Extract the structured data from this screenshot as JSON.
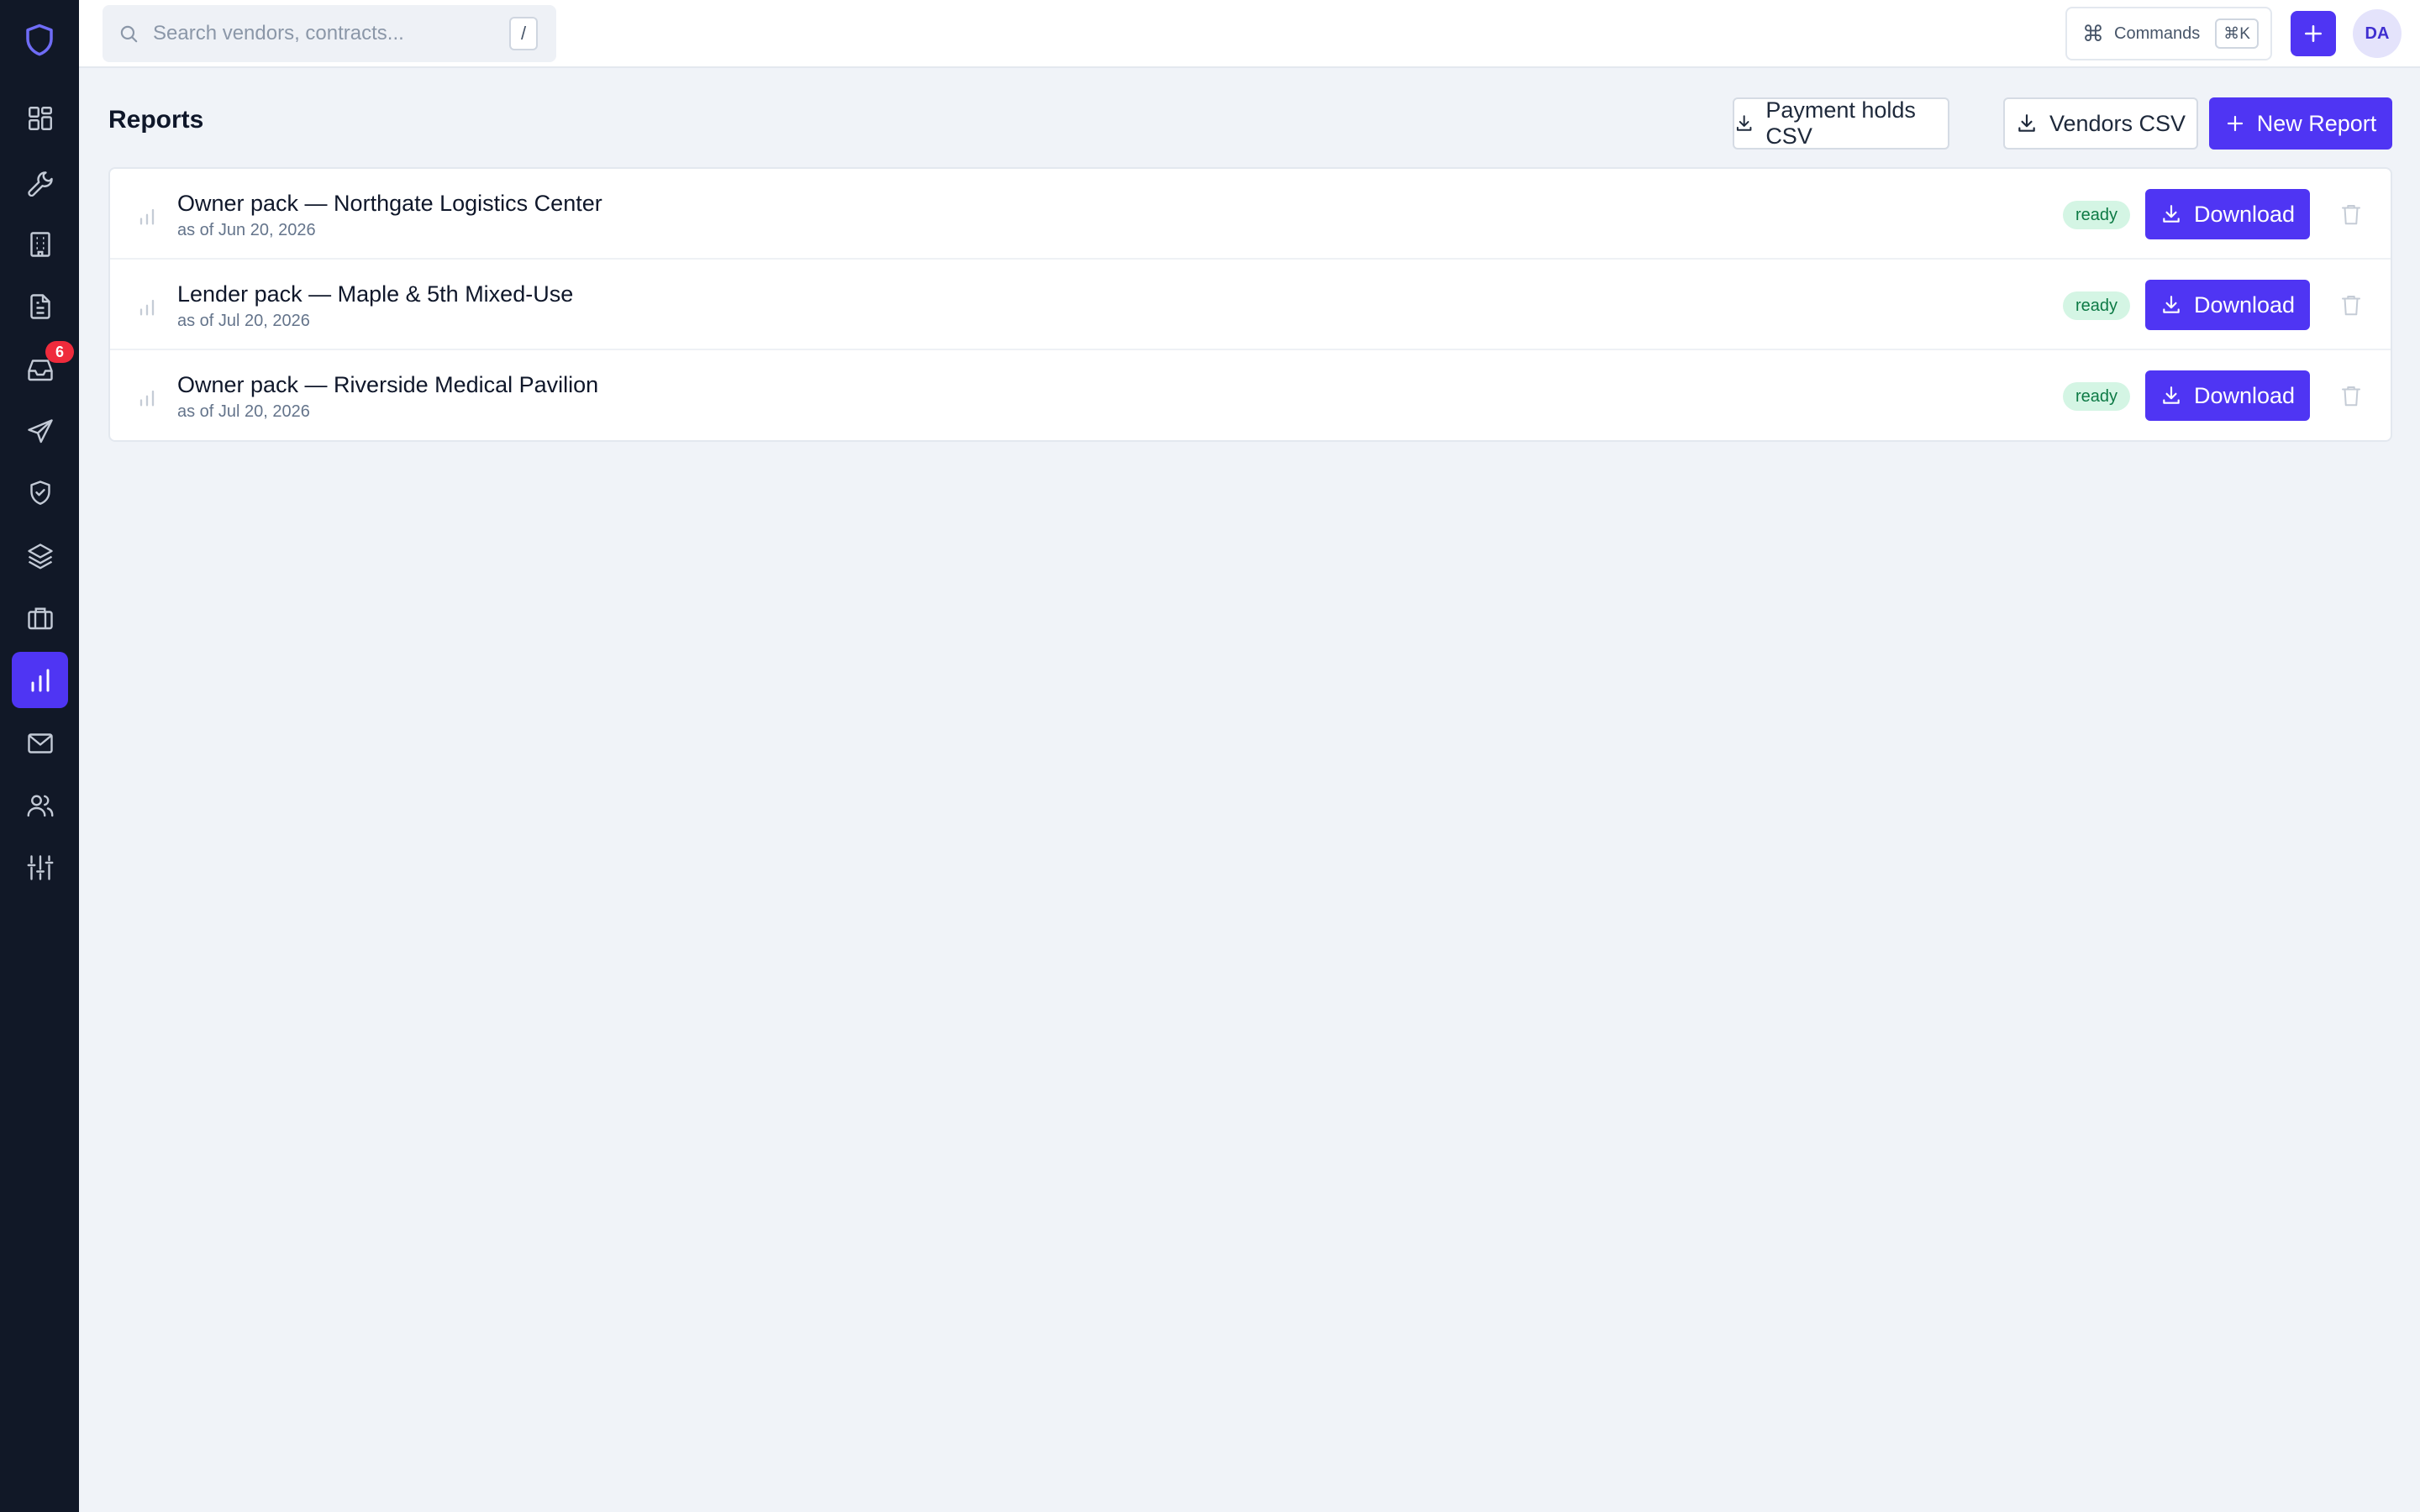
{
  "search": {
    "placeholder": "Search vendors, contracts...",
    "shortcut": "/"
  },
  "topbar": {
    "commands_label": "Commands",
    "commands_shortcut": "⌘K",
    "avatar_initials": "DA"
  },
  "sidebar": {
    "items": [
      {
        "name": "dashboard",
        "icon": "grid-icon"
      },
      {
        "name": "tools",
        "icon": "wrench-icon"
      },
      {
        "name": "buildings",
        "icon": "building-icon"
      },
      {
        "name": "documents",
        "icon": "file-text-icon"
      },
      {
        "name": "inbox",
        "icon": "inbox-icon",
        "badge": "6"
      },
      {
        "name": "send",
        "icon": "send-icon"
      },
      {
        "name": "compliance",
        "icon": "shield-check-icon"
      },
      {
        "name": "layers",
        "icon": "layers-icon"
      },
      {
        "name": "briefcase",
        "icon": "briefcase-icon"
      },
      {
        "name": "reports",
        "icon": "bar-chart-icon",
        "active": true
      },
      {
        "name": "mail",
        "icon": "mail-icon"
      },
      {
        "name": "users",
        "icon": "users-icon"
      },
      {
        "name": "settings",
        "icon": "sliders-icon"
      }
    ]
  },
  "header": {
    "title": "Reports",
    "payment_holds_label": "Payment holds CSV",
    "vendors_label": "Vendors CSV",
    "new_report_label": "New Report"
  },
  "reports": [
    {
      "title": "Owner pack — Northgate Logistics Center",
      "as_of": "as of Jun 20, 2026",
      "status": "ready",
      "download_label": "Download"
    },
    {
      "title": "Lender pack — Maple & 5th Mixed-Use",
      "as_of": "as of Jul 20, 2026",
      "status": "ready",
      "download_label": "Download"
    },
    {
      "title": "Owner pack — Riverside Medical Pavilion",
      "as_of": "as of Jul 20, 2026",
      "status": "ready",
      "download_label": "Download"
    }
  ],
  "colors": {
    "sidebar_bg": "#111827",
    "accent": "#4f35f3",
    "page_bg": "#f0f3f8",
    "status_ready_bg": "#d4f5e4",
    "status_ready_text": "#0d7a45",
    "badge": "#ef2b3c"
  }
}
